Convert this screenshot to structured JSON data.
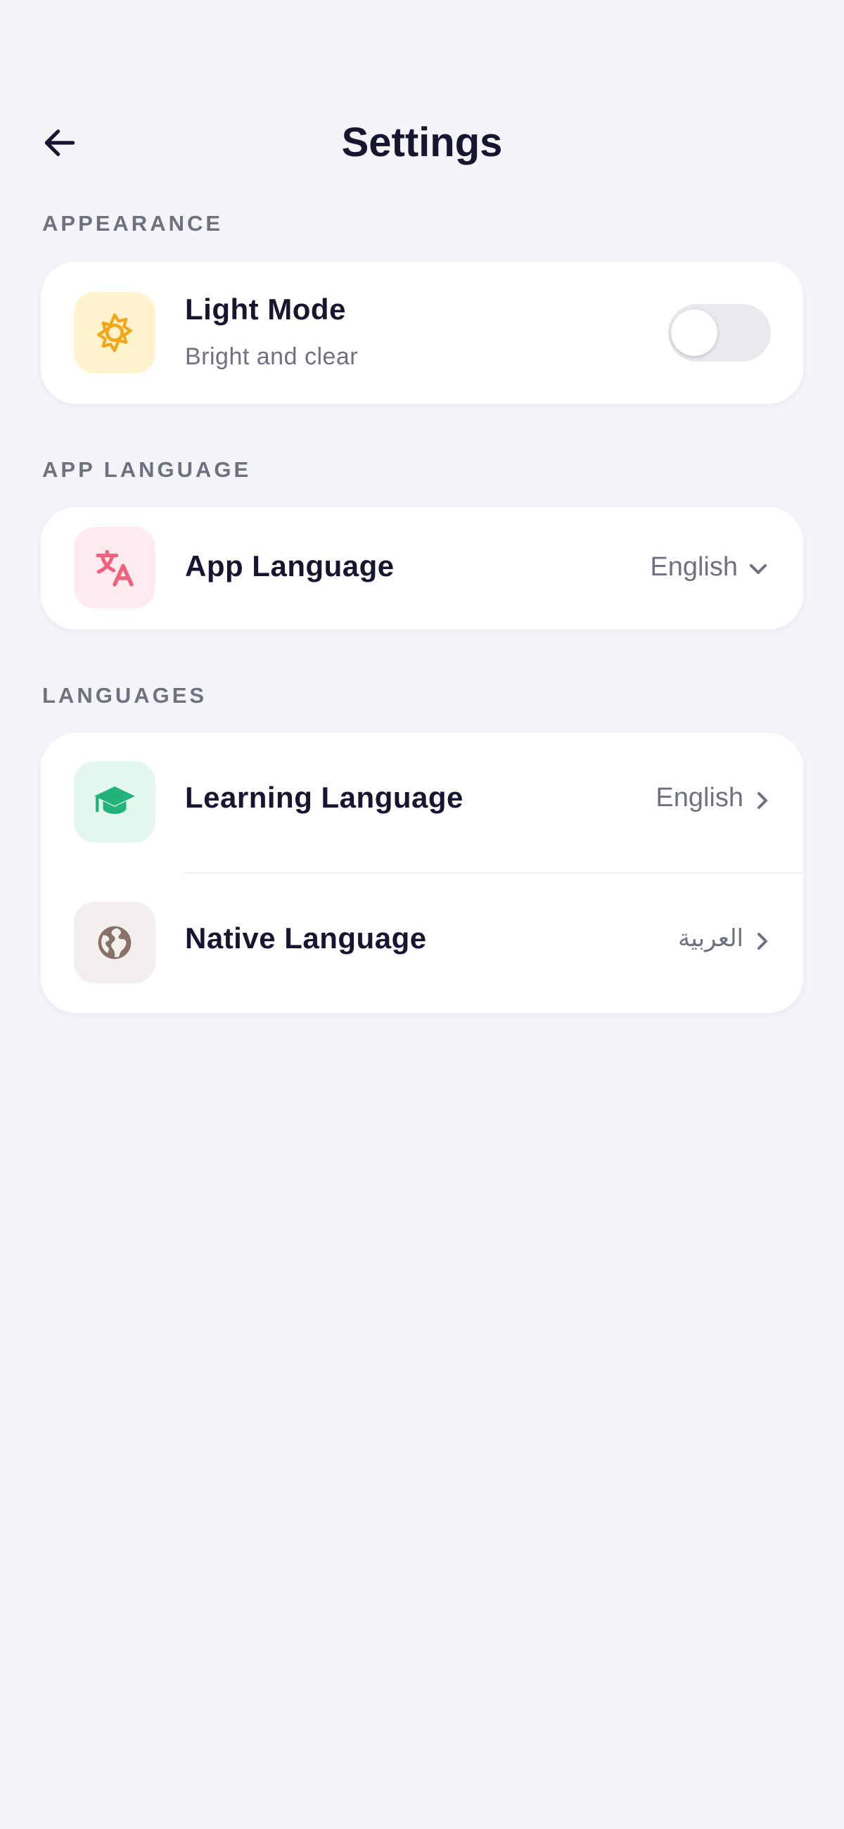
{
  "header": {
    "title": "Settings",
    "back_icon": "arrow-left-icon"
  },
  "sections": {
    "appearance": {
      "label": "APPEARANCE",
      "light_mode": {
        "title": "Light Mode",
        "subtitle": "Bright and clear",
        "icon": "sun-icon",
        "icon_color": "#f2a71b",
        "tile_color": "#fff3cd",
        "toggle_on": false
      }
    },
    "app_language": {
      "label": "APP LANGUAGE",
      "item": {
        "title": "App Language",
        "value": "English",
        "icon": "translate-icon",
        "icon_color": "#f0607a",
        "tile_color": "#ffebef"
      }
    },
    "languages": {
      "label": "LANGUAGES",
      "learning": {
        "title": "Learning Language",
        "value": "English",
        "icon": "graduation-cap-icon",
        "icon_color": "#22b37a",
        "tile_color": "#e4f7ee"
      },
      "native": {
        "title": "Native Language",
        "value": "العربية",
        "icon": "globe-icon",
        "icon_color": "#8a7168",
        "tile_color": "#f3efee"
      }
    }
  }
}
